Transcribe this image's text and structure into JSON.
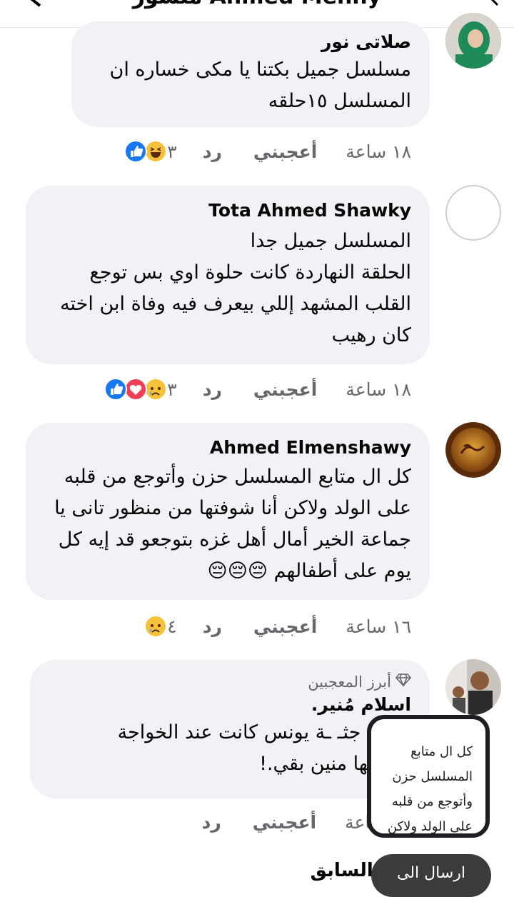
{
  "header": {
    "title": "منشور Ahmed Menny"
  },
  "comments": [
    {
      "author": "صلاتى نور",
      "text": "مسلسل جميل بكتنا يا مكى  خساره ان\nالمسلسل ١٥حلقه",
      "time": "١٨ ساعة",
      "like": "أعجبني",
      "reply": "رد",
      "reaction_count": "٣",
      "reactions": [
        "like",
        "haha"
      ]
    },
    {
      "author": "Tota Ahmed Shawky",
      "text": "المسلسل جميل جدا\nالحلقة النهاردة كانت حلوة اوي بس توجع\nالقلب المشهد إللي بيعرف فيه وفاة ابن اخته\nكان رهيب",
      "time": "١٨ ساعة",
      "like": "أعجبني",
      "reply": "رد",
      "reaction_count": "٣",
      "reactions": [
        "like",
        "love",
        "sad"
      ]
    },
    {
      "author": "Ahmed Elmenshawy",
      "text": "كل ال متابع المسلسل حزن وأتوجع من قلبه\nعلى الولد ولاكن أنا شوفتها من منظور تانى يا\nجماعة الخير أمال أهل غزه بتوجعو قد إيه كل\nيوم على أطفالهم 😔😔😔",
      "time": "١٦ ساعة",
      "like": "أعجبني",
      "reply": "رد",
      "reaction_count": "٤",
      "reactions": [
        "sad"
      ]
    },
    {
      "badge": "أبرز المعجبين",
      "author": "اسلام مُنير.",
      "text": "لطة.. جثـ ـة يونس كانت عند الخواجة\nل جابها منين بقي.!",
      "time": "ساعة",
      "like": "أعجبني",
      "reply": "رد"
    }
  ],
  "popup": {
    "text": "كل ال متابع\nالمسلسل حزن\nوأتوجع من قلبه\nعلى الولد ولاكن"
  },
  "send_button": "ارسال الى",
  "previous_replies": "الرد السابق",
  "colors": {
    "bubble": "#f0f2f5",
    "meta": "#65676b",
    "like_blue": "#1877f2"
  }
}
